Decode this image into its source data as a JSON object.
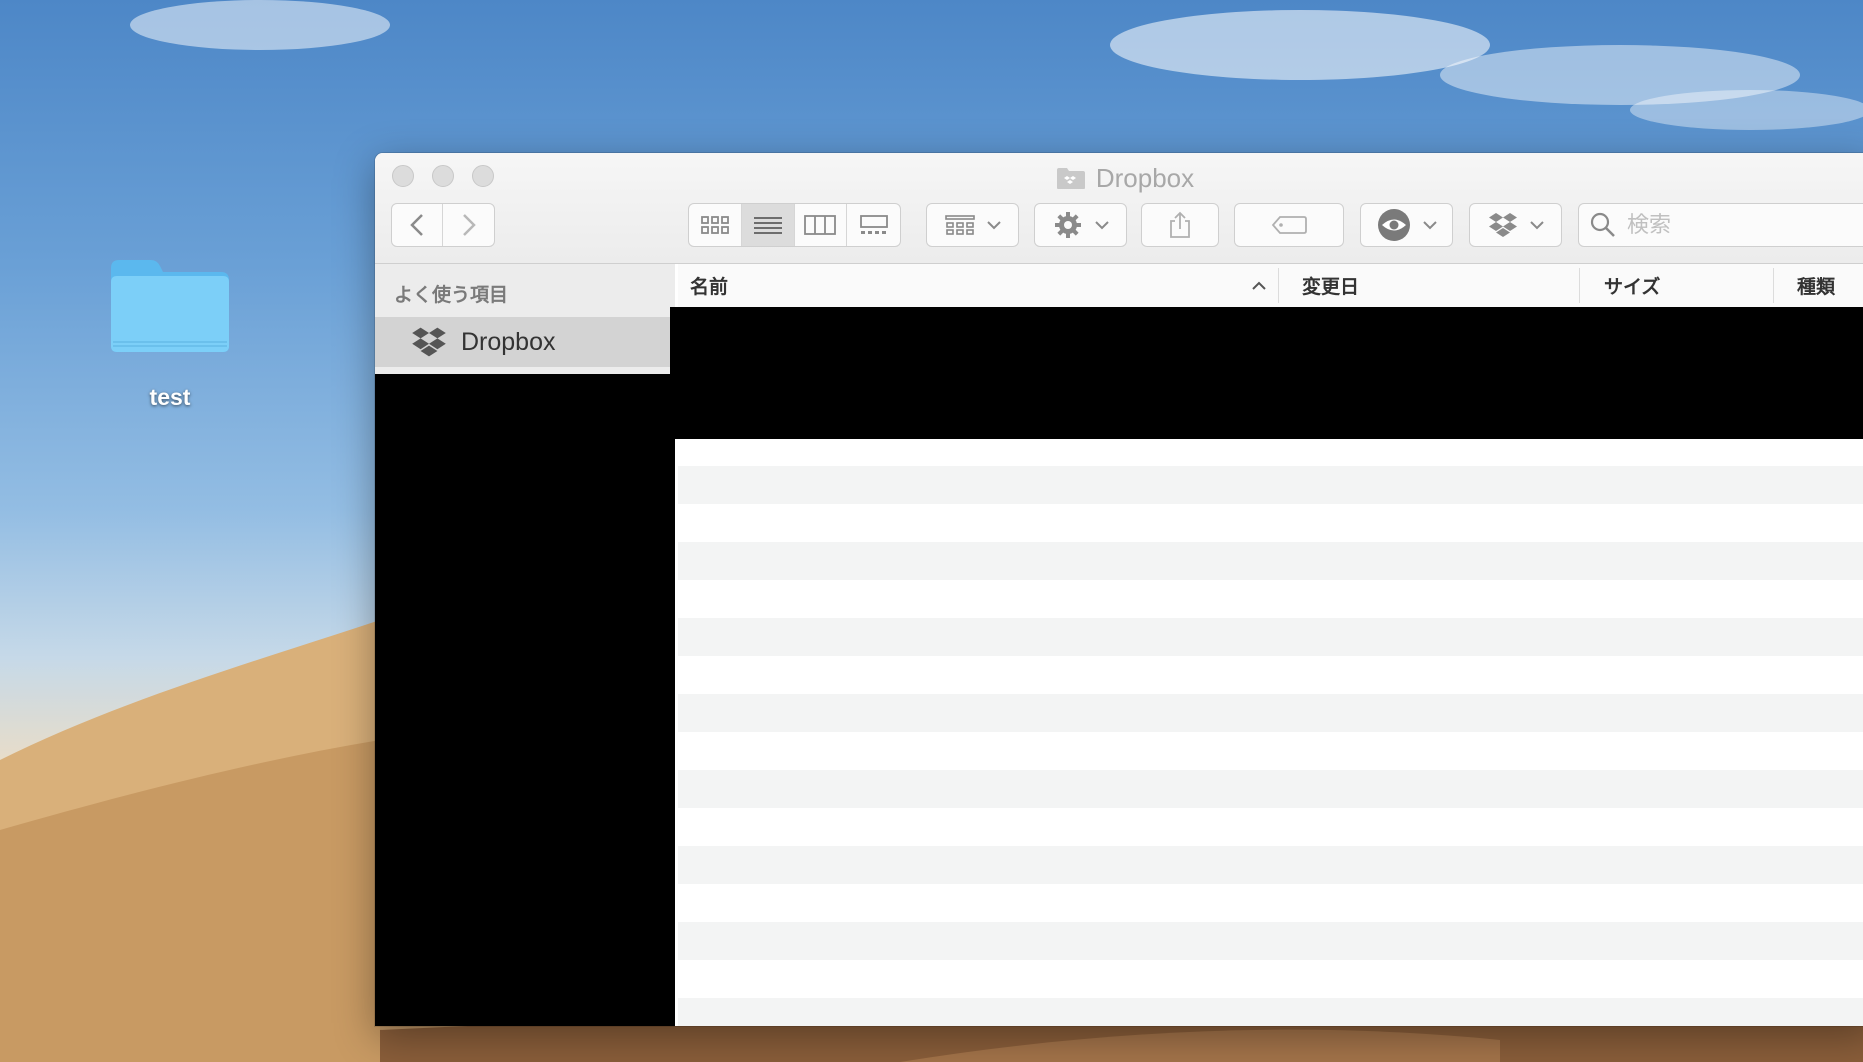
{
  "desktop": {
    "folder_label": "test"
  },
  "window": {
    "title": "Dropbox",
    "search_placeholder": "検索"
  },
  "sidebar": {
    "section_title": "よく使う項目",
    "items": [
      {
        "label": "Dropbox",
        "icon": "dropbox-icon",
        "selected": true
      }
    ]
  },
  "list": {
    "columns": [
      {
        "label": "名前",
        "sort": "ascending"
      },
      {
        "label": "変更日"
      },
      {
        "label": "サイズ"
      },
      {
        "label": "種類"
      }
    ]
  },
  "colors": {
    "window_bg": "#ffffff",
    "stripe": "#f3f4f4",
    "sidebar_selected": "#d3d3d3",
    "folder_blue": "#6cc8f5"
  }
}
